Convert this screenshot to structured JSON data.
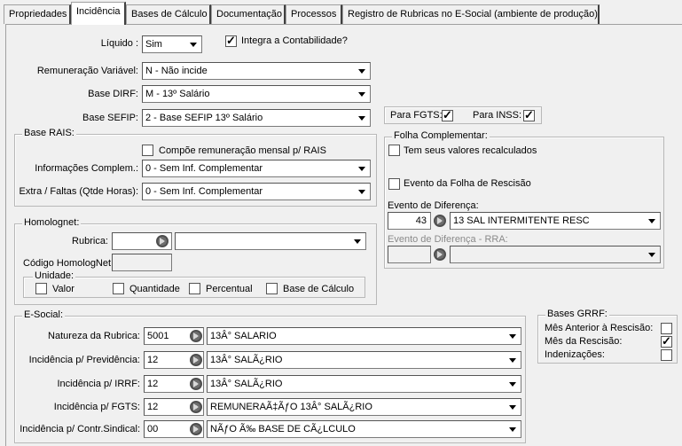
{
  "tabs": [
    "Propriedades",
    "Incidência",
    "Bases de Cálculo",
    "Documentação",
    "Processos",
    "Registro de Rubricas no E-Social (ambiente de produção)"
  ],
  "top": {
    "liquido_label": "Líquido :",
    "liquido_value": "Sim",
    "integra_label": "Integra a Contabilidade?",
    "remun_label": "Remuneração Variável:",
    "remun_value": "N - Não incide",
    "dirf_label": "Base DIRF:",
    "dirf_value": "M - 13º Salário",
    "sefip_label": "Base SEFIP:",
    "sefip_value": "2 - Base SEFIP 13º Salário",
    "fgts_label": "Para FGTS:",
    "inss_label": "Para INSS:"
  },
  "rais": {
    "title": "Base RAIS:",
    "compoe_label": "Compõe remuneração mensal p/ RAIS",
    "info_label": "Informações Complem.:",
    "info_value": "0 - Sem Inf. Complementar",
    "extra_label": "Extra / Faltas (Qtde Horas):",
    "extra_value": "0 - Sem Inf. Complementar"
  },
  "folha": {
    "title": "Folha Complementar:",
    "recalc_label": "Tem seus valores recalculados",
    "rescisao_label": "Evento da Folha de Rescisão",
    "evento_label": "Evento de Diferença:",
    "evento_code": "43",
    "evento_value": "13 SAL INTERMITENTE RESC",
    "rra_label": "Evento de Diferença - RRA:"
  },
  "homolognet": {
    "title": "Homolognet:",
    "rubrica_label": "Rubrica:",
    "codigo_label": "Código HomologNet",
    "unidade_label": "Unidade:",
    "valor_label": "Valor",
    "quantidade_label": "Quantidade",
    "percentual_label": "Percentual",
    "base_label": "Base de Cálculo"
  },
  "esocial": {
    "title": "E-Social:",
    "rows": [
      {
        "label": "Natureza da Rubrica:",
        "code": "5001",
        "value": "13Â° SALARIO"
      },
      {
        "label": "Incidência p/ Previdência:",
        "code": "12",
        "value": "13Â° SALÃ¿RIO"
      },
      {
        "label": "Incidência p/ IRRF:",
        "code": "12",
        "value": "13Â° SALÃ¿RIO"
      },
      {
        "label": "Incidência p/ FGTS:",
        "code": "12",
        "value": "REMUNERAÃ‡ÃƒO 13Â° SALÃ¿RIO"
      },
      {
        "label": "Incidência p/ Contr.Sindical:",
        "code": "00",
        "value": "NÃƒO Ã‰ BASE DE CÃ¿LCULO"
      }
    ]
  },
  "grrf": {
    "title": "Bases GRRF:",
    "anterior_label": "Mês Anterior à Rescisão:",
    "mes_label": "Mês da Rescisão:",
    "indenizacoes_label": "Indenizações:"
  }
}
